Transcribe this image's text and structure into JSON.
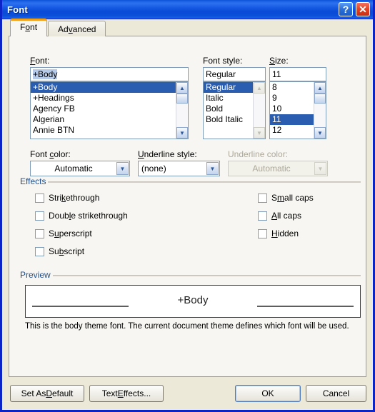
{
  "window": {
    "title": "Font",
    "help_button": "?",
    "close_button": "✕"
  },
  "tabs": [
    {
      "label_pre": "F",
      "label_hot": "o",
      "label_post": "nt",
      "label": "Font",
      "active": true
    },
    {
      "label_pre": "Ad",
      "label_hot": "v",
      "label_post": "anced",
      "label": "Advanced",
      "active": false
    }
  ],
  "font_section": {
    "label_pre": "",
    "label_hot": "F",
    "label_post": "ont:",
    "label": "Font:",
    "value": "+Body",
    "items": [
      "+Body",
      "+Headings",
      "Agency FB",
      "Algerian",
      "Annie BTN"
    ],
    "selected_index": 0
  },
  "style_section": {
    "label": "Font style:",
    "value": "Regular",
    "items": [
      "Regular",
      "Italic",
      "Bold",
      "Bold Italic"
    ],
    "selected_index": 0
  },
  "size_section": {
    "label_hot": "S",
    "label_post": "ize:",
    "label": "Size:",
    "value": "11",
    "items": [
      "8",
      "9",
      "10",
      "11",
      "12"
    ],
    "selected_index": 3
  },
  "font_color": {
    "label_pre": "Font ",
    "label_hot": "c",
    "label_post": "olor:",
    "label": "Font color:",
    "value": "Automatic",
    "enabled": true
  },
  "underline_style": {
    "label_hot": "U",
    "label_post": "nderline style:",
    "label": "Underline style:",
    "value": "(none)",
    "enabled": true
  },
  "underline_color": {
    "label": "Underline color:",
    "value": "Automatic",
    "enabled": false
  },
  "effects": {
    "group_label": "Effects",
    "left_column": [
      {
        "label_pre": "Stri",
        "label_hot": "k",
        "label_post": "ethrough",
        "label": "Strikethrough",
        "checked": false
      },
      {
        "label_pre": "Doub",
        "label_hot": "l",
        "label_post": "e strikethrough",
        "label": "Double strikethrough",
        "checked": false
      },
      {
        "label_pre": "S",
        "label_hot": "u",
        "label_post": "perscript",
        "label": "Superscript",
        "checked": false
      },
      {
        "label_pre": "Su",
        "label_hot": "b",
        "label_post": "script",
        "label": "Subscript",
        "checked": false
      }
    ],
    "right_column": [
      {
        "label_pre": "S",
        "label_hot": "m",
        "label_post": "all caps",
        "label": "Small caps",
        "checked": false
      },
      {
        "label_pre": "",
        "label_hot": "A",
        "label_post": "ll caps",
        "label": "All caps",
        "checked": false
      },
      {
        "label_pre": "",
        "label_hot": "H",
        "label_post": "idden",
        "label": "Hidden",
        "checked": false
      }
    ]
  },
  "preview": {
    "group_label": "Preview",
    "sample_text": "+Body",
    "note": "This is the body theme font. The current document theme defines which font will be used."
  },
  "buttons": {
    "set_as_default": {
      "pre": "Set As ",
      "hot": "D",
      "post": "efault",
      "label": "Set As Default"
    },
    "text_effects": {
      "pre": "Text ",
      "hot": "E",
      "post": "ffects...",
      "label": "Text Effects..."
    },
    "ok": "OK",
    "cancel": "Cancel"
  },
  "colors": {
    "titlebar_blue": "#0a4ad6",
    "window_border": "#0a24c8",
    "dialog_face": "#ece9d8",
    "tab_page": "#f7f6f2",
    "selection_blue": "#2a5db0",
    "group_label_blue": "#1d4f8f",
    "active_tab_accent": "#f0a017",
    "disabled_text": "#aca899"
  }
}
